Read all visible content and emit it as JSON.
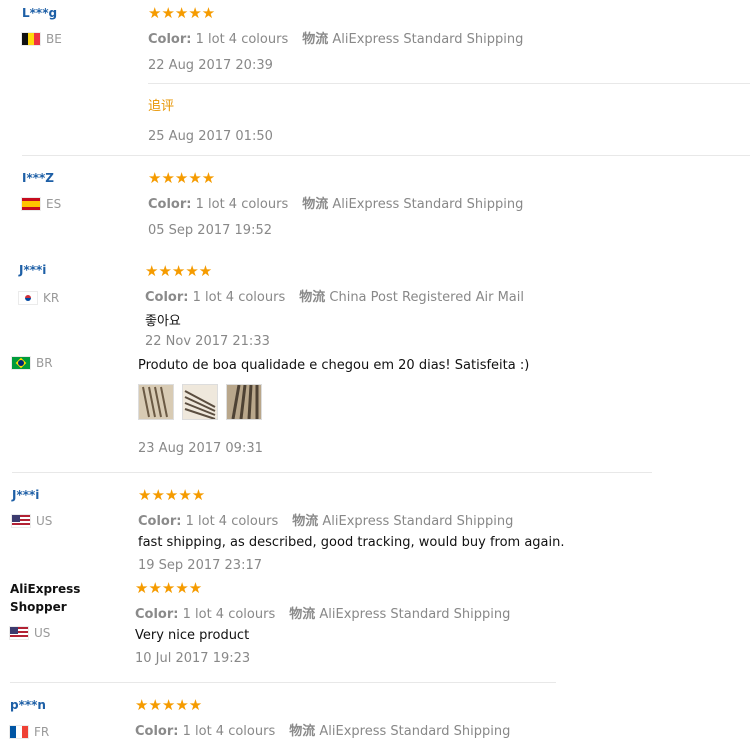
{
  "reviews": [
    {
      "name": "L***g",
      "country": "BE",
      "flag": "be-flag",
      "stars": "★★★★★",
      "color_label": "Color:",
      "color_value": "1 lot 4 colours",
      "logistics_label": "物流",
      "logistics_value": "AliExpress Standard Shipping",
      "date": "22 Aug 2017 20:39",
      "additional_label": "追评",
      "additional_date": "25 Aug 2017 01:50"
    },
    {
      "name": "I***Z",
      "country": "ES",
      "flag": "es-flag",
      "stars": "★★★★★",
      "color_label": "Color:",
      "color_value": "1 lot 4 colours",
      "logistics_label": "物流",
      "logistics_value": "AliExpress Standard Shipping",
      "date": "05 Sep 2017 19:52"
    },
    {
      "name": "J***i",
      "country": "KR",
      "flag": "kr-flag",
      "stars": "★★★★★",
      "color_label": "Color:",
      "color_value": "1 lot 4 colours",
      "logistics_label": "物流",
      "logistics_value": "China Post Registered Air Mail",
      "text": "좋아요",
      "date": "22 Nov 2017 21:33"
    },
    {
      "name": "",
      "country": "BR",
      "flag": "br-flag",
      "text": "Produto de boa qualidade e chegou em 20 dias! Satisfeita :)",
      "photos": [
        "photo-1",
        "photo-2",
        "photo-3"
      ],
      "date": "23 Aug 2017 09:31"
    },
    {
      "name": "J***i",
      "country": "US",
      "flag": "us-flag",
      "stars": "★★★★★",
      "color_label": "Color:",
      "color_value": "1 lot 4 colours",
      "logistics_label": "物流",
      "logistics_value": "AliExpress Standard Shipping",
      "text": "fast shipping, as described, good tracking, would buy from again.",
      "date": "19 Sep 2017 23:17"
    },
    {
      "name": "AliExpress Shopper",
      "country": "US",
      "flag": "us-flag",
      "stars": "★★★★★",
      "color_label": "Color:",
      "color_value": "1 lot 4 colours",
      "logistics_label": "物流",
      "logistics_value": "AliExpress Standard Shipping",
      "text": "Very nice product",
      "date": "10 Jul 2017 19:23"
    },
    {
      "name": "p***n",
      "country": "FR",
      "flag": "fr-flag",
      "stars": "★★★★★",
      "color_label": "Color:",
      "color_value": "1 lot 4 colours",
      "logistics_label": "物流",
      "logistics_value": "AliExpress Standard Shipping"
    }
  ],
  "colors": {
    "star": "#f59b00",
    "name_link": "#1d5fa6",
    "additional": "#e79400",
    "meta": "#888888"
  }
}
